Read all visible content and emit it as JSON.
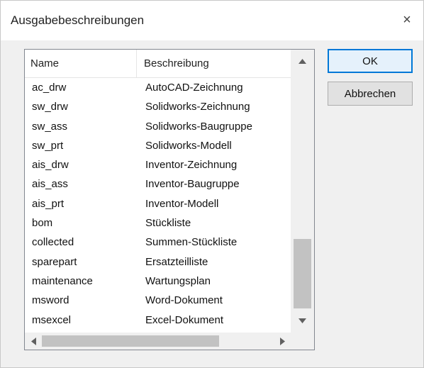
{
  "window": {
    "title": "Ausgabebeschreibungen",
    "close_label": "×"
  },
  "list": {
    "columns": [
      "Name",
      "Beschreibung"
    ],
    "rows": [
      {
        "name": "ac_drw",
        "description": "AutoCAD-Zeichnung"
      },
      {
        "name": "sw_drw",
        "description": "Solidworks-Zeichnung"
      },
      {
        "name": "sw_ass",
        "description": "Solidworks-Baugruppe"
      },
      {
        "name": "sw_prt",
        "description": "Solidworks-Modell"
      },
      {
        "name": "ais_drw",
        "description": "Inventor-Zeichnung"
      },
      {
        "name": "ais_ass",
        "description": "Inventor-Baugruppe"
      },
      {
        "name": "ais_prt",
        "description": "Inventor-Modell"
      },
      {
        "name": "bom",
        "description": "Stückliste"
      },
      {
        "name": "collected",
        "description": "Summen-Stückliste"
      },
      {
        "name": "sparepart",
        "description": "Ersatzteilliste"
      },
      {
        "name": "maintenance",
        "description": "Wartungsplan"
      },
      {
        "name": "msword",
        "description": "Word-Dokument"
      },
      {
        "name": "msexcel",
        "description": "Excel-Dokument"
      }
    ]
  },
  "buttons": {
    "ok_label": "OK",
    "cancel_label": "Abbrechen"
  },
  "icons": {
    "close": "close-icon",
    "scroll_up": "chevron-up-icon",
    "scroll_down": "chevron-down-icon",
    "scroll_left": "chevron-left-icon",
    "scroll_right": "chevron-right-icon"
  }
}
